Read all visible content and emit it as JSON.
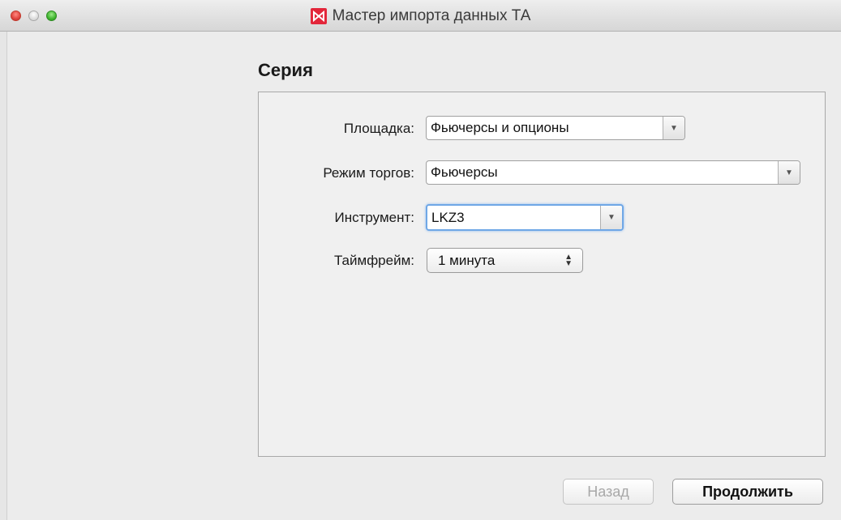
{
  "window": {
    "title": "Мастер импорта данных ТА"
  },
  "page": {
    "heading": "Серия"
  },
  "form": {
    "venue": {
      "label": "Площадка:",
      "value": "Фьючерсы и опционы"
    },
    "trade_mode": {
      "label": "Режим торгов:",
      "value": "Фьючерсы"
    },
    "instrument": {
      "label": "Инструмент:",
      "value": "LKZ3"
    },
    "timeframe": {
      "label": "Таймфрейм:",
      "value": "1 минута"
    }
  },
  "buttons": {
    "back": "Назад",
    "continue": "Продолжить"
  },
  "icons": {
    "app": "app-logo-icon",
    "dropdown": "chevron-down-icon",
    "stepper": "up-down-arrows-icon"
  },
  "colors": {
    "focus_ring": "#6fa7e6",
    "app_icon": "#e3263a"
  }
}
